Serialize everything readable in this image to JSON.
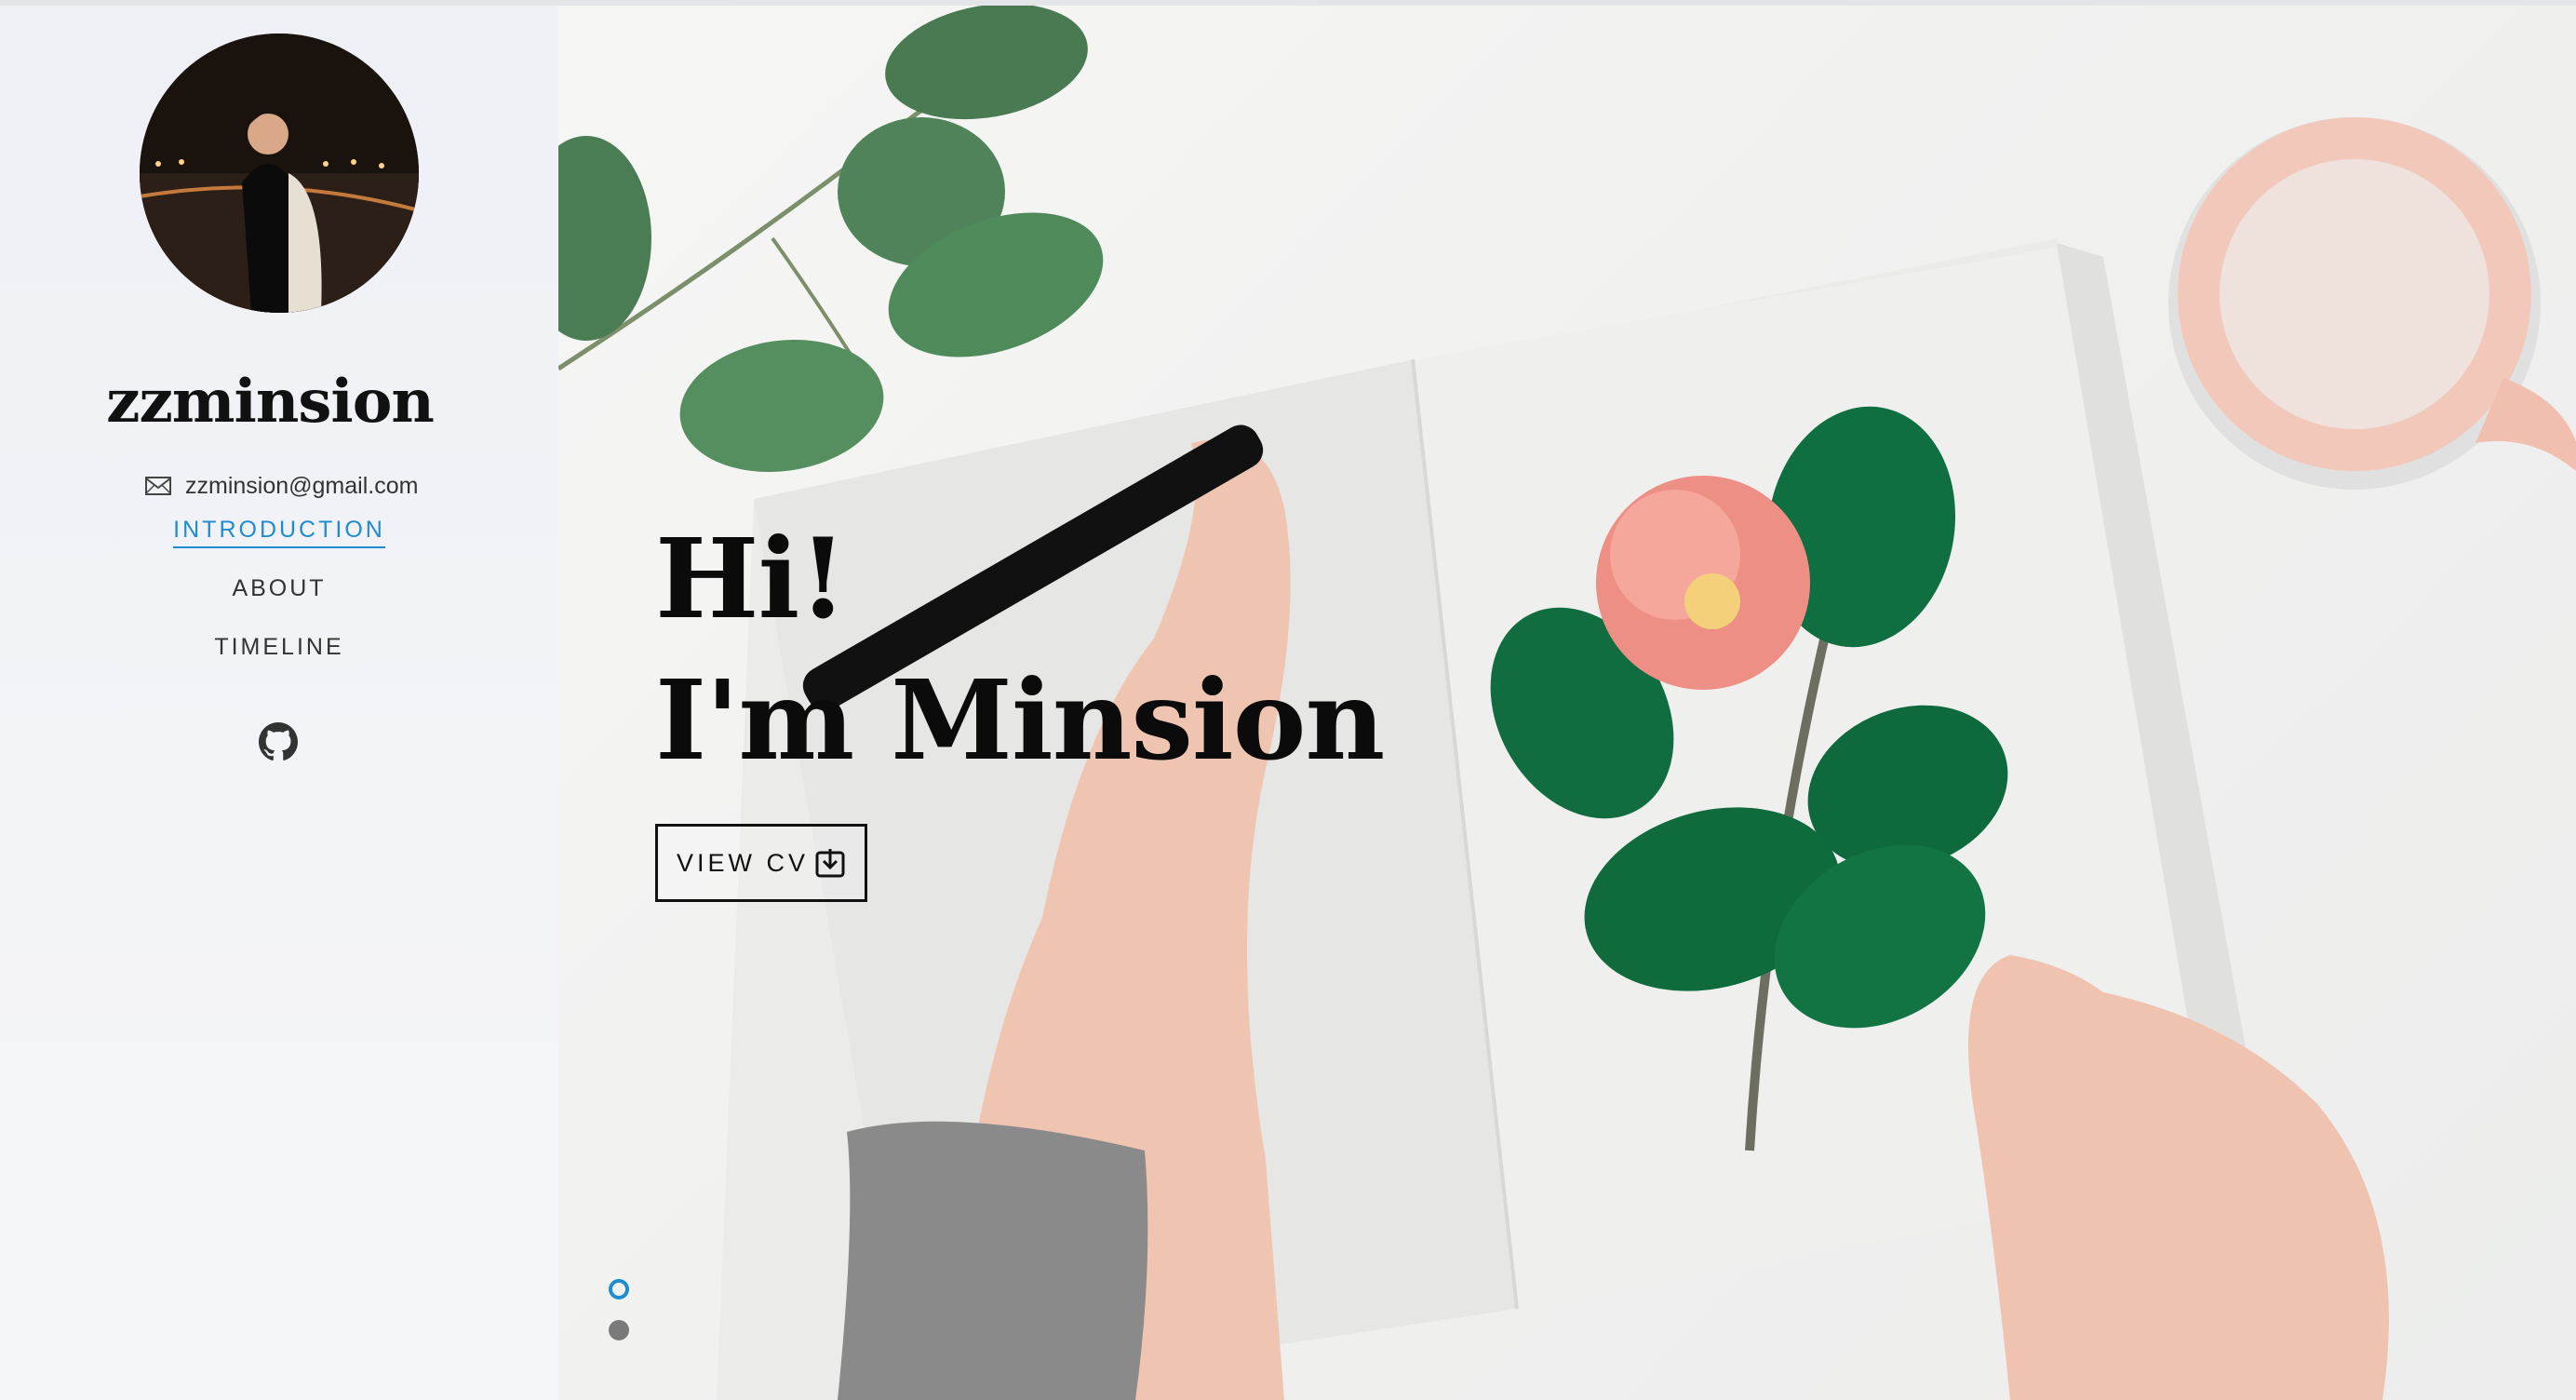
{
  "profile": {
    "name": "zzminsion",
    "email": "zzminsion@gmail.com",
    "avatar_icon": "profile-photo"
  },
  "nav": {
    "items": [
      {
        "label": "INTRODUCTION",
        "active": true
      },
      {
        "label": "ABOUT",
        "active": false
      },
      {
        "label": "TIMELINE",
        "active": false
      }
    ]
  },
  "social": {
    "github_icon": "github-icon"
  },
  "hero": {
    "line1": "Hi!",
    "line2": "I'm Minsion",
    "cv_label": "VIEW CV",
    "cv_icon": "download-icon"
  },
  "slider": {
    "dot_count": 2,
    "active_index": 0
  },
  "colors": {
    "accent": "#1f8bd1",
    "text": "#111111",
    "sidebar_bg": "#eef0f5"
  }
}
